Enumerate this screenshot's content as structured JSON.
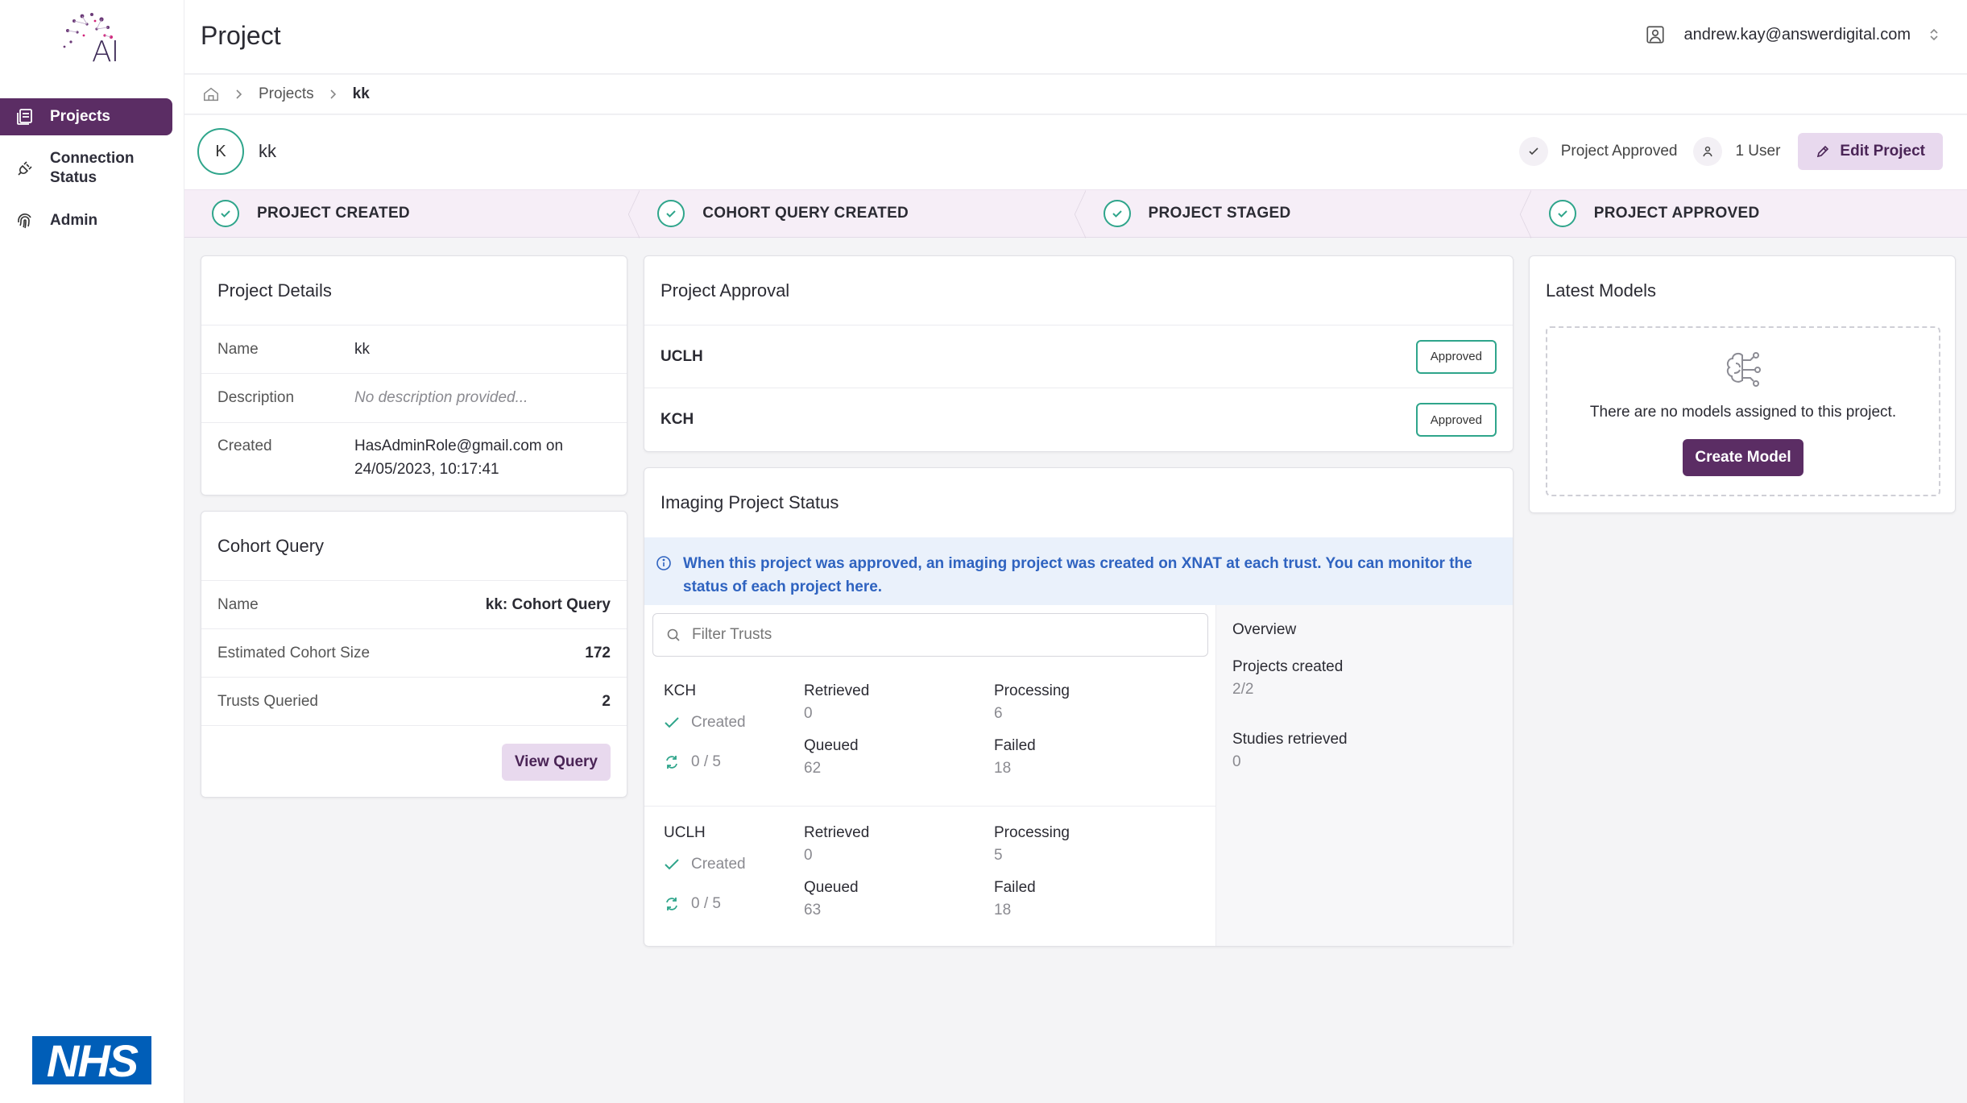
{
  "app": {
    "logo_text": "AI",
    "nhs_logo": "NHS"
  },
  "sidebar": {
    "items": [
      {
        "label": "Projects",
        "icon": "projects-icon",
        "active": true
      },
      {
        "label": "Connection Status",
        "icon": "plug-icon",
        "active": false
      },
      {
        "label": "Admin",
        "icon": "fingerprint-icon",
        "active": false
      }
    ]
  },
  "header": {
    "title": "Project",
    "user_email": "andrew.kay@answerdigital.com"
  },
  "breadcrumb": {
    "items": [
      "Projects",
      "kk"
    ]
  },
  "project": {
    "avatar_initial": "K",
    "name": "kk",
    "status": "Project Approved",
    "users": "1 User",
    "edit_label": "Edit Project"
  },
  "stepper": {
    "steps": [
      "PROJECT CREATED",
      "COHORT QUERY CREATED",
      "PROJECT STAGED",
      "PROJECT APPROVED"
    ]
  },
  "project_details": {
    "title": "Project Details",
    "name_label": "Name",
    "name_value": "kk",
    "description_label": "Description",
    "description_value": "No description provided...",
    "created_label": "Created",
    "created_by": "HasAdminRole@gmail.com",
    "created_on_word": "on",
    "created_at": "24/05/2023, 10:17:41"
  },
  "cohort_query": {
    "title": "Cohort Query",
    "rows": [
      {
        "label": "Name",
        "value": "kk: Cohort Query"
      },
      {
        "label": "Estimated Cohort Size",
        "value": "172"
      },
      {
        "label": "Trusts Queried",
        "value": "2"
      }
    ],
    "view_label": "View Query"
  },
  "project_approval": {
    "title": "Project Approval",
    "rows": [
      {
        "trust": "UCLH",
        "status": "Approved"
      },
      {
        "trust": "KCH",
        "status": "Approved"
      }
    ]
  },
  "imaging_status": {
    "title": "Imaging Project Status",
    "info": "When this project was approved, an imaging project was created on XNAT at each trust. You can monitor the status of each project here.",
    "filter_placeholder": "Filter Trusts",
    "labels": {
      "created": "Created",
      "retrieved": "Retrieved",
      "processing": "Processing",
      "queued": "Queued",
      "failed": "Failed"
    },
    "trusts": [
      {
        "name": "KCH",
        "progress": "0 / 5",
        "retrieved": "0",
        "processing": "6",
        "queued": "62",
        "failed": "18"
      },
      {
        "name": "UCLH",
        "progress": "0 / 5",
        "retrieved": "0",
        "processing": "5",
        "queued": "63",
        "failed": "18"
      }
    ],
    "overview": {
      "title": "Overview",
      "projects_created_label": "Projects created",
      "projects_created_value": "2/2",
      "studies_retrieved_label": "Studies retrieved",
      "studies_retrieved_value": "0"
    }
  },
  "latest_models": {
    "title": "Latest Models",
    "empty_message": "There are no models assigned to this project.",
    "create_label": "Create Model"
  },
  "colors": {
    "brand_purple": "#5b2d64",
    "soft_purple": "#e8d9ee",
    "success_green": "#2fa58b",
    "info_blue": "#2f63c0",
    "nhs_blue": "#005eb8"
  }
}
